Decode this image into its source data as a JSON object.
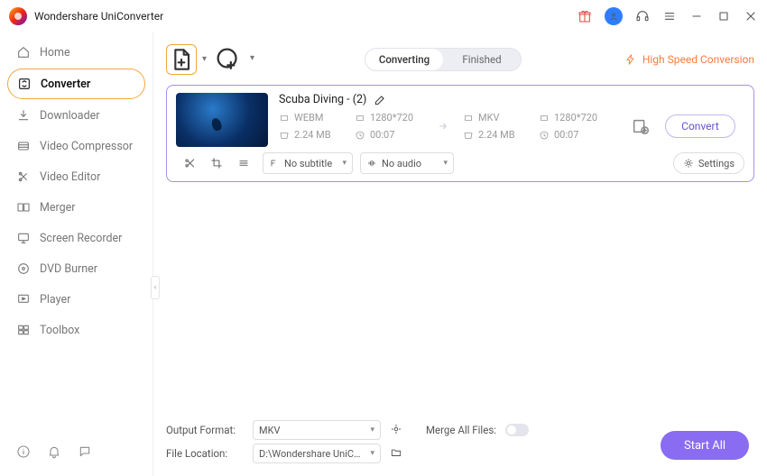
{
  "app": {
    "title": "Wondershare UniConverter"
  },
  "titlebar_icons": [
    "gift-icon",
    "avatar-icon",
    "headset-icon",
    "menu-icon",
    "minimize-icon",
    "maximize-icon",
    "close-icon"
  ],
  "sidebar": {
    "items": [
      {
        "icon": "home",
        "label": "Home"
      },
      {
        "icon": "converter",
        "label": "Converter"
      },
      {
        "icon": "downloader",
        "label": "Downloader"
      },
      {
        "icon": "compressor",
        "label": "Video Compressor"
      },
      {
        "icon": "editor",
        "label": "Video Editor"
      },
      {
        "icon": "merger",
        "label": "Merger"
      },
      {
        "icon": "recorder",
        "label": "Screen Recorder"
      },
      {
        "icon": "dvd",
        "label": "DVD Burner"
      },
      {
        "icon": "player",
        "label": "Player"
      },
      {
        "icon": "toolbox",
        "label": "Toolbox"
      }
    ],
    "active_index": 1
  },
  "toolbar": {
    "tabs": {
      "converting": "Converting",
      "finished": "Finished",
      "active": "converting"
    },
    "high_speed": "High Speed Conversion"
  },
  "task": {
    "filename": "Scuba Diving - (2)",
    "source": {
      "format": "WEBM",
      "resolution": "1280*720",
      "size": "2.24 MB",
      "duration": "00:07"
    },
    "target": {
      "format": "MKV",
      "resolution": "1280*720",
      "size": "2.24 MB",
      "duration": "00:07"
    },
    "subtitle": "No subtitle",
    "audio": "No audio",
    "settings_label": "Settings",
    "convert_label": "Convert"
  },
  "footer": {
    "output_format_label": "Output Format:",
    "output_format_value": "MKV",
    "merge_label": "Merge All Files:",
    "file_location_label": "File Location:",
    "file_location_value": "D:\\Wondershare UniConverter",
    "start_all": "Start All"
  }
}
